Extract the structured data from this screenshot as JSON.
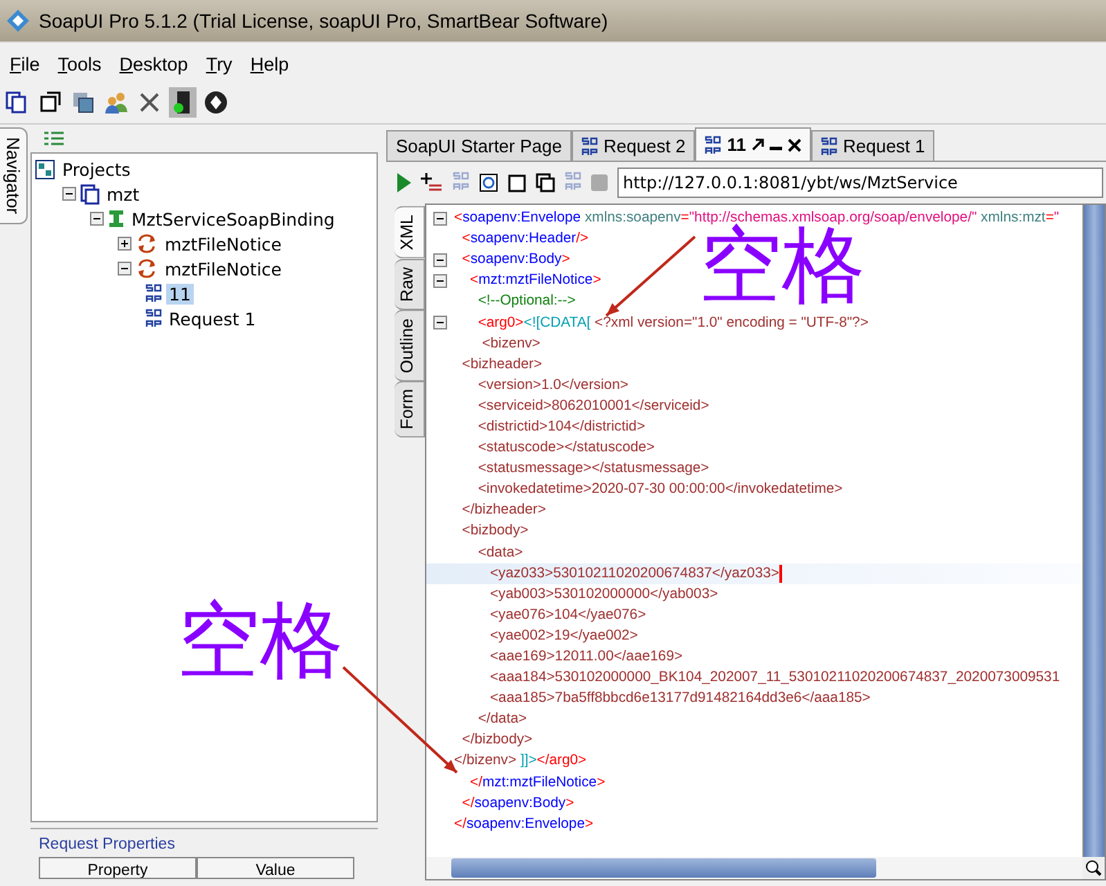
{
  "window": {
    "title": "SoapUI Pro 5.1.2 (Trial License, soapUI Pro, SmartBear Software)"
  },
  "menu": [
    {
      "label": "File"
    },
    {
      "label": "Tools"
    },
    {
      "label": "Desktop"
    },
    {
      "label": "Try"
    },
    {
      "label": "Help"
    }
  ],
  "navigator": {
    "tab": "Navigator",
    "tree": [
      {
        "label": "Projects",
        "kind": "projects",
        "selected": false,
        "children": [
          {
            "label": "mzt",
            "kind": "project",
            "selected": false,
            "expanded": true,
            "children": [
              {
                "label": "MztServiceSoapBinding",
                "kind": "interface",
                "selected": false,
                "expanded": true,
                "children": [
                  {
                    "label": "mztFileNotice",
                    "kind": "operation",
                    "selected": false,
                    "expanded": false
                  },
                  {
                    "label": "mztFileNotice",
                    "kind": "operation",
                    "selected": false,
                    "expanded": true,
                    "children": [
                      {
                        "label": "11",
                        "kind": "request",
                        "selected": true
                      },
                      {
                        "label": "Request 1",
                        "kind": "request",
                        "selected": false
                      }
                    ]
                  }
                ]
              }
            ]
          }
        ]
      }
    ]
  },
  "request_properties": {
    "title": "Request Properties",
    "columns": [
      "Property",
      "Value"
    ]
  },
  "editor_tabs": [
    {
      "label": "SoapUI Starter Page",
      "kind": "page",
      "selected": false
    },
    {
      "label": "Request 2",
      "kind": "request",
      "selected": false
    },
    {
      "label": "11",
      "kind": "request",
      "selected": true
    },
    {
      "label": "Request 1",
      "kind": "request",
      "selected": false
    }
  ],
  "endpoint": "http://127.0.0.1:8081/ybt/ws/MztService",
  "side_tabs": [
    {
      "label": "XML",
      "selected": true
    },
    {
      "label": "Raw",
      "selected": false
    },
    {
      "label": "Outline",
      "selected": false
    },
    {
      "label": "Form",
      "selected": false
    }
  ],
  "code_lines": [
    {
      "fold": true,
      "current": false,
      "parts": [
        {
          "kind": "punct",
          "text": "<"
        },
        {
          "kind": "name",
          "text": "soapenv:Envelope"
        },
        {
          "kind": "attr",
          "text": " xmlns:soapenv"
        },
        {
          "kind": "punct",
          "text": "="
        },
        {
          "kind": "value",
          "text": "\"http://schemas.xmlsoap.org/soap/envelope/\""
        },
        {
          "kind": "attr",
          "text": " xmlns:mzt"
        },
        {
          "kind": "punct",
          "text": "="
        },
        {
          "kind": "value",
          "text": "\""
        }
      ]
    },
    {
      "fold": false,
      "current": false,
      "parts": [
        {
          "kind": "punct",
          "text": "  <"
        },
        {
          "kind": "name",
          "text": "soapenv:Header"
        },
        {
          "kind": "punct",
          "text": "/>"
        }
      ]
    },
    {
      "fold": true,
      "current": false,
      "parts": [
        {
          "kind": "punct",
          "text": "  <"
        },
        {
          "kind": "name",
          "text": "soapenv:Body"
        },
        {
          "kind": "punct",
          "text": ">"
        }
      ]
    },
    {
      "fold": true,
      "current": false,
      "parts": [
        {
          "kind": "punct",
          "text": "    <"
        },
        {
          "kind": "name",
          "text": "mzt:mztFileNotice"
        },
        {
          "kind": "punct",
          "text": ">"
        }
      ]
    },
    {
      "fold": false,
      "current": false,
      "parts": [
        {
          "kind": "comment",
          "text": "      <!--Optional:-->"
        }
      ]
    },
    {
      "fold": true,
      "current": false,
      "parts": [
        {
          "kind": "punct",
          "text": "      <arg0>"
        },
        {
          "kind": "cdata",
          "text": "<![CDATA["
        },
        {
          "kind": "text",
          "text": " <?xml version=\"1.0\" encoding = \"UTF-8\"?>"
        }
      ]
    },
    {
      "fold": false,
      "current": false,
      "parts": [
        {
          "kind": "text",
          "text": "       <bizenv>"
        }
      ]
    },
    {
      "fold": false,
      "current": false,
      "parts": [
        {
          "kind": "text",
          "text": "  <bizheader>"
        }
      ]
    },
    {
      "fold": false,
      "current": false,
      "parts": [
        {
          "kind": "text",
          "text": "      <version>1.0</version>"
        }
      ]
    },
    {
      "fold": false,
      "current": false,
      "parts": [
        {
          "kind": "text",
          "text": "      <serviceid>8062010001</serviceid>"
        }
      ]
    },
    {
      "fold": false,
      "current": false,
      "parts": [
        {
          "kind": "text",
          "text": "      <districtid>104</districtid>"
        }
      ]
    },
    {
      "fold": false,
      "current": false,
      "parts": [
        {
          "kind": "text",
          "text": "      <statuscode></statuscode>"
        }
      ]
    },
    {
      "fold": false,
      "current": false,
      "parts": [
        {
          "kind": "text",
          "text": "      <statusmessage></statusmessage>"
        }
      ]
    },
    {
      "fold": false,
      "current": false,
      "parts": [
        {
          "kind": "text",
          "text": "      <invokedatetime>2020-07-30 00:00:00</invokedatetime>"
        }
      ]
    },
    {
      "fold": false,
      "current": false,
      "parts": [
        {
          "kind": "text",
          "text": "  </bizheader>"
        }
      ]
    },
    {
      "fold": false,
      "current": false,
      "parts": [
        {
          "kind": "text",
          "text": "  <bizbody>"
        }
      ]
    },
    {
      "fold": false,
      "current": false,
      "parts": [
        {
          "kind": "text",
          "text": "      <data>"
        }
      ]
    },
    {
      "fold": false,
      "current": true,
      "parts": [
        {
          "kind": "text",
          "text": "         <yaz033>53010211020200674837</yaz033>"
        }
      ]
    },
    {
      "fold": false,
      "current": false,
      "parts": [
        {
          "kind": "text",
          "text": "         <yab003>530102000000</yab003>"
        }
      ]
    },
    {
      "fold": false,
      "current": false,
      "parts": [
        {
          "kind": "text",
          "text": "         <yae076>104</yae076>"
        }
      ]
    },
    {
      "fold": false,
      "current": false,
      "parts": [
        {
          "kind": "text",
          "text": "         <yae002>19</yae002>"
        }
      ]
    },
    {
      "fold": false,
      "current": false,
      "parts": [
        {
          "kind": "text",
          "text": "         <aae169>12011.00</aae169>"
        }
      ]
    },
    {
      "fold": false,
      "current": false,
      "parts": [
        {
          "kind": "text",
          "text": "         <aaa184>530102000000_BK104_202007_11_53010211020200674837_2020073009531"
        }
      ]
    },
    {
      "fold": false,
      "current": false,
      "parts": [
        {
          "kind": "text",
          "text": "         <aaa185>7ba5ff8bbcd6e13177d91482164dd3e6</aaa185>"
        }
      ]
    },
    {
      "fold": false,
      "current": false,
      "parts": [
        {
          "kind": "text",
          "text": "      </data>"
        }
      ]
    },
    {
      "fold": false,
      "current": false,
      "parts": [
        {
          "kind": "text",
          "text": "  </bizbody>"
        }
      ]
    },
    {
      "fold": false,
      "current": false,
      "parts": [
        {
          "kind": "text",
          "text": "</bizenv> "
        },
        {
          "kind": "cdata",
          "text": "]]>"
        },
        {
          "kind": "punct",
          "text": "</arg0>"
        }
      ]
    },
    {
      "fold": false,
      "current": false,
      "parts": [
        {
          "kind": "punct",
          "text": "    </"
        },
        {
          "kind": "name",
          "text": "mzt:mztFileNotice"
        },
        {
          "kind": "punct",
          "text": ">"
        }
      ]
    },
    {
      "fold": false,
      "current": false,
      "parts": [
        {
          "kind": "punct",
          "text": "  </"
        },
        {
          "kind": "name",
          "text": "soapenv:Body"
        },
        {
          "kind": "punct",
          "text": ">"
        }
      ]
    },
    {
      "fold": false,
      "current": false,
      "parts": [
        {
          "kind": "punct",
          "text": "</"
        },
        {
          "kind": "name",
          "text": "soapenv:Envelope"
        },
        {
          "kind": "punct",
          "text": ">"
        }
      ]
    }
  ],
  "annotations": [
    {
      "label": "空格"
    },
    {
      "label": "空格"
    }
  ]
}
